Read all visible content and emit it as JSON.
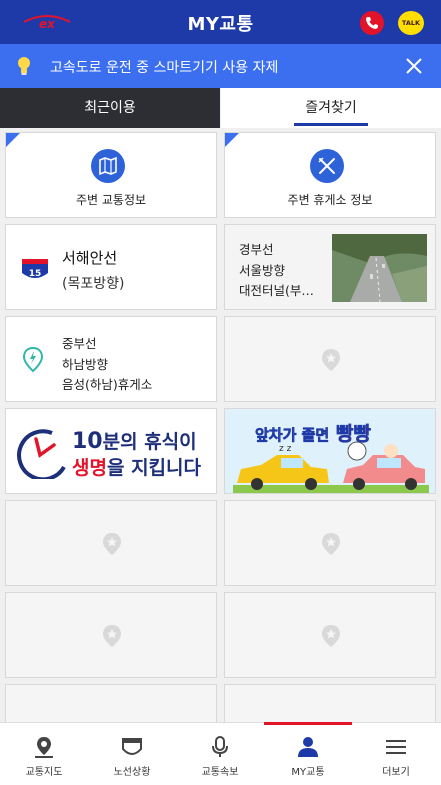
{
  "header": {
    "title": "MY교통",
    "logo_text": "ex",
    "talk_label": "TALK",
    "icons": [
      "ex-logo-icon",
      "phone-icon",
      "kakaotalk-icon"
    ]
  },
  "notice": {
    "text": "고속도로 운전 중 스마트기기 사용 자제",
    "icons": [
      "lightbulb-icon",
      "close-icon"
    ]
  },
  "tabs": [
    {
      "label": "최근이용",
      "active": false
    },
    {
      "label": "즐겨찾기",
      "active": true
    }
  ],
  "favorites": {
    "nearby_traffic": {
      "label": "주변 교통정보",
      "icon": "map-icon"
    },
    "nearby_rest": {
      "label": "주변 휴게소 정보",
      "icon": "fork-knife-icon"
    },
    "route": {
      "number": "15",
      "name": "서해안선",
      "direction": "(목포방향)"
    },
    "cctv": {
      "line": "경부선",
      "direction": "서울방향",
      "location": "대전터널(부…"
    },
    "rest_area": {
      "line": "중부선",
      "direction": "하남방향",
      "name": "음성(하남)휴게소"
    },
    "banner_rest": {
      "num": "10",
      "text1": "분의 휴식이",
      "text2a": "생명",
      "text2b": "을 지킵니다"
    },
    "banner_drowsy": {
      "text_a": "앞차가 ",
      "text_b": "졸면",
      "text_c": " 빵빵",
      "zz": "z z"
    },
    "empty_icon": "location-star-icon"
  },
  "colors": {
    "brand_blue": "#1e3aa8",
    "accent_blue": "#3b6ff0",
    "red": "#e3132a",
    "dark_tab": "#2c2e33"
  },
  "bottom_nav": [
    {
      "label": "교통지도",
      "icon": "map-pin-icon",
      "active": false
    },
    {
      "label": "노선상황",
      "icon": "road-shield-icon",
      "active": false
    },
    {
      "label": "교통속보",
      "icon": "microphone-icon",
      "active": false
    },
    {
      "label": "MY교통",
      "icon": "my-user-icon",
      "active": true
    },
    {
      "label": "더보기",
      "icon": "hamburger-menu-icon",
      "active": false
    }
  ]
}
